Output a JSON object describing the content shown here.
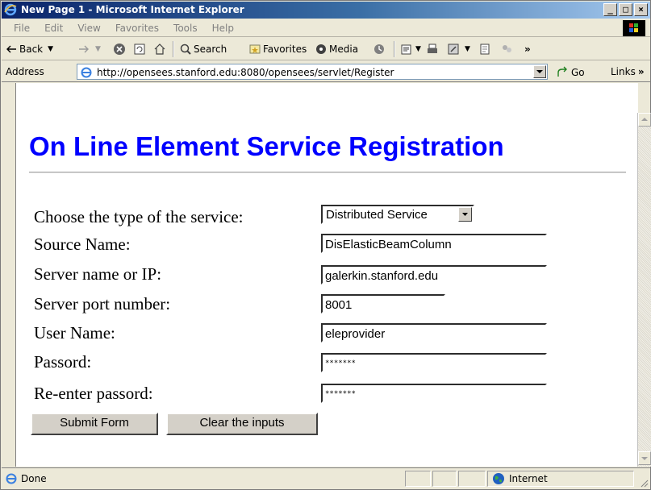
{
  "window": {
    "title": "New Page 1 - Microsoft Internet Explorer",
    "min_glyph": "_",
    "max_glyph": "□",
    "close_glyph": "×"
  },
  "menubar": {
    "items": [
      "File",
      "Edit",
      "View",
      "Favorites",
      "Tools",
      "Help"
    ]
  },
  "toolbar": {
    "back_label": "Back",
    "search_label": "Search",
    "favorites_label": "Favorites",
    "media_label": "Media",
    "overflow_glyph": "»"
  },
  "address": {
    "label": "Address",
    "url": "http://opensees.stanford.edu:8080/opensees/servlet/Register",
    "go_label": "Go",
    "links_label": "Links"
  },
  "page": {
    "heading": "On Line Element Service Registration",
    "form": {
      "service_type_label": "Choose the type of the service:",
      "service_type_value": "Distributed Service",
      "source_name_label": "Source Name:",
      "source_name_value": "DisElasticBeamColumn",
      "server_label": "Server name or IP:",
      "server_value": "galerkin.stanford.edu",
      "port_label": "Server port number:",
      "port_value": "8001",
      "username_label": "User Name:",
      "username_value": "eleprovider",
      "password_label": "Passord:",
      "password_mask": "*******",
      "reenter_label": "Re-enter passord:",
      "reenter_mask": "*******",
      "submit_label": "Submit Form",
      "clear_label": "Clear the inputs"
    }
  },
  "statusbar": {
    "status": "Done",
    "zone": "Internet"
  },
  "colors": {
    "heading": "#0000ff",
    "titlebar_start": "#0a246a",
    "titlebar_end": "#a6caf0"
  }
}
